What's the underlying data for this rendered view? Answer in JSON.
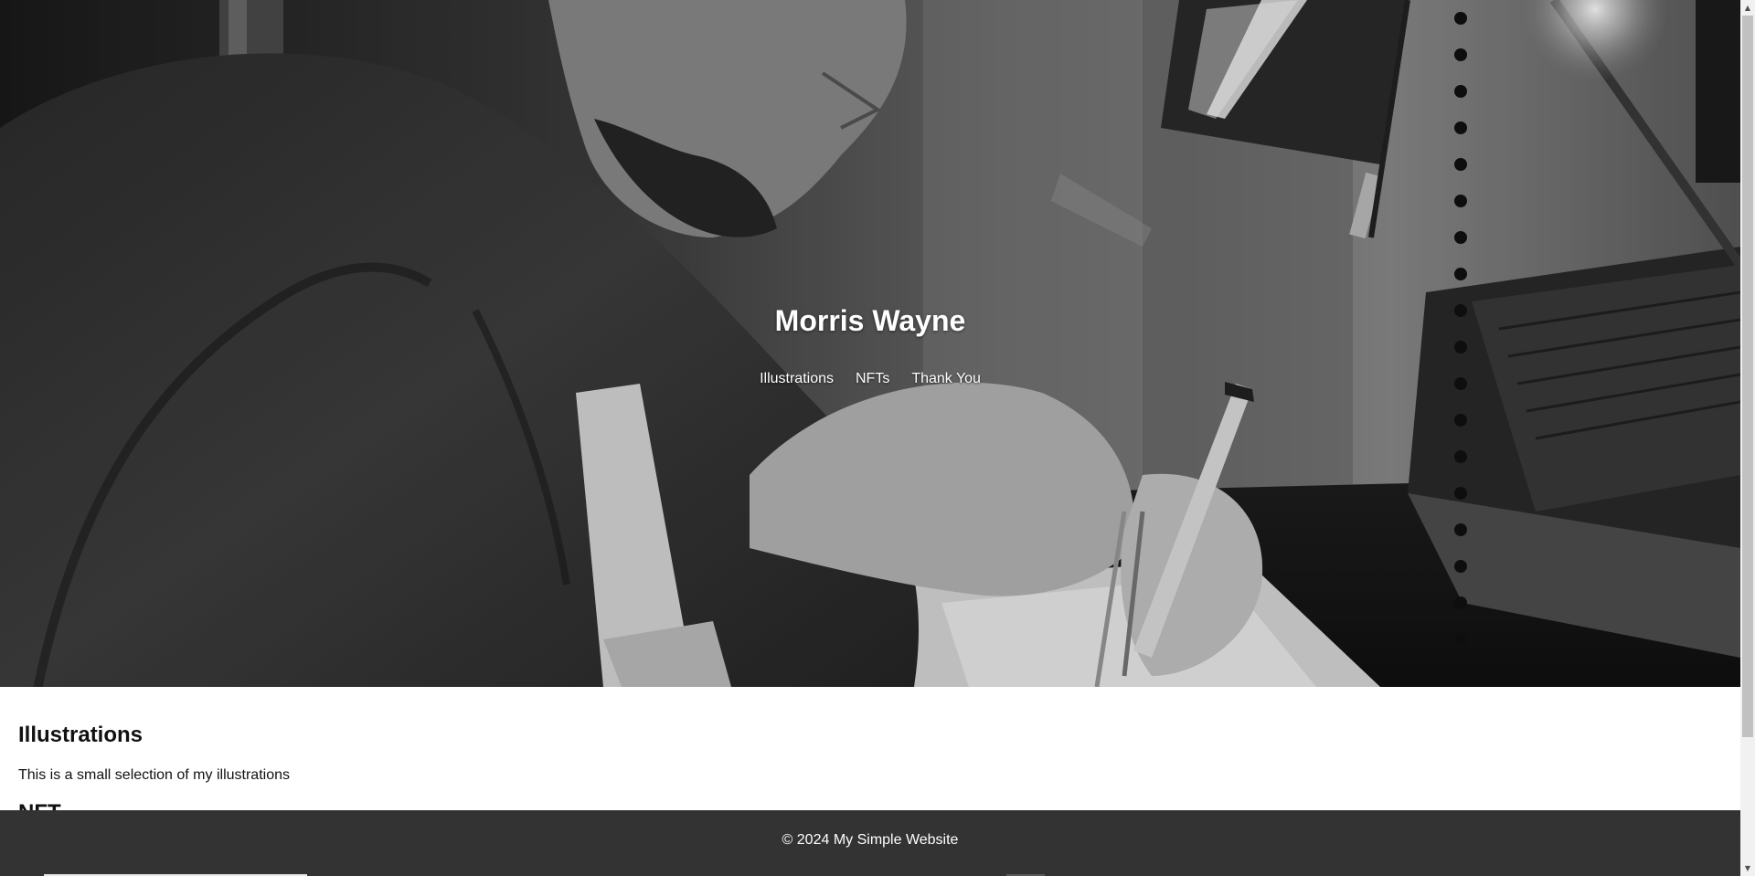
{
  "hero": {
    "title": "Morris Wayne",
    "nav": [
      {
        "label": "Illustrations"
      },
      {
        "label": "NFTs"
      },
      {
        "label": "Thank You"
      }
    ]
  },
  "sections": {
    "illustrations": {
      "heading": "Illustrations",
      "text": "This is a small selection of my illustrations"
    },
    "nft": {
      "heading": "NFT"
    }
  },
  "footer": {
    "text": "© 2024 My Simple Website"
  },
  "colors": {
    "footer_bg": "#333333",
    "hero_text": "#ffffff",
    "page_bg": "#ffffff"
  },
  "scrollbar": {
    "up_icon": "scroll-up-arrow-icon",
    "down_icon": "scroll-down-arrow-icon"
  }
}
